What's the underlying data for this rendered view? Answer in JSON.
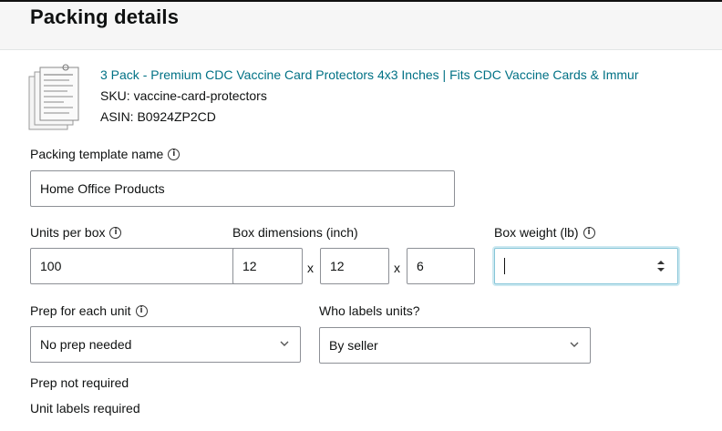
{
  "header": {
    "title": "Packing details"
  },
  "product": {
    "title": "3 Pack - Premium CDC Vaccine Card Protectors 4x3 Inches | Fits CDC Vaccine Cards & Immur",
    "sku": "SKU: vaccine-card-protectors",
    "asin": "ASIN: B0924ZP2CD",
    "thumbnail_icon": "vaccine-card-protector-thumbnail"
  },
  "form": {
    "template_name": {
      "label": "Packing template name",
      "value": "Home Office Products"
    },
    "units_per_box": {
      "label": "Units per box",
      "value": "100"
    },
    "box_dimensions": {
      "label": "Box dimensions (inch)",
      "length": "12",
      "width": "12",
      "height": "6",
      "separator": "x"
    },
    "box_weight": {
      "label": "Box weight (lb)",
      "value": ""
    },
    "prep": {
      "label": "Prep for each unit",
      "value": "No prep needed"
    },
    "labels": {
      "label": "Who labels units?",
      "value": "By seller"
    }
  },
  "status": {
    "prep_note": "Prep not required",
    "label_note": "Unit labels required"
  },
  "colors": {
    "link": "#007185",
    "border": "#8d9096",
    "focus": "#86c5d8"
  }
}
